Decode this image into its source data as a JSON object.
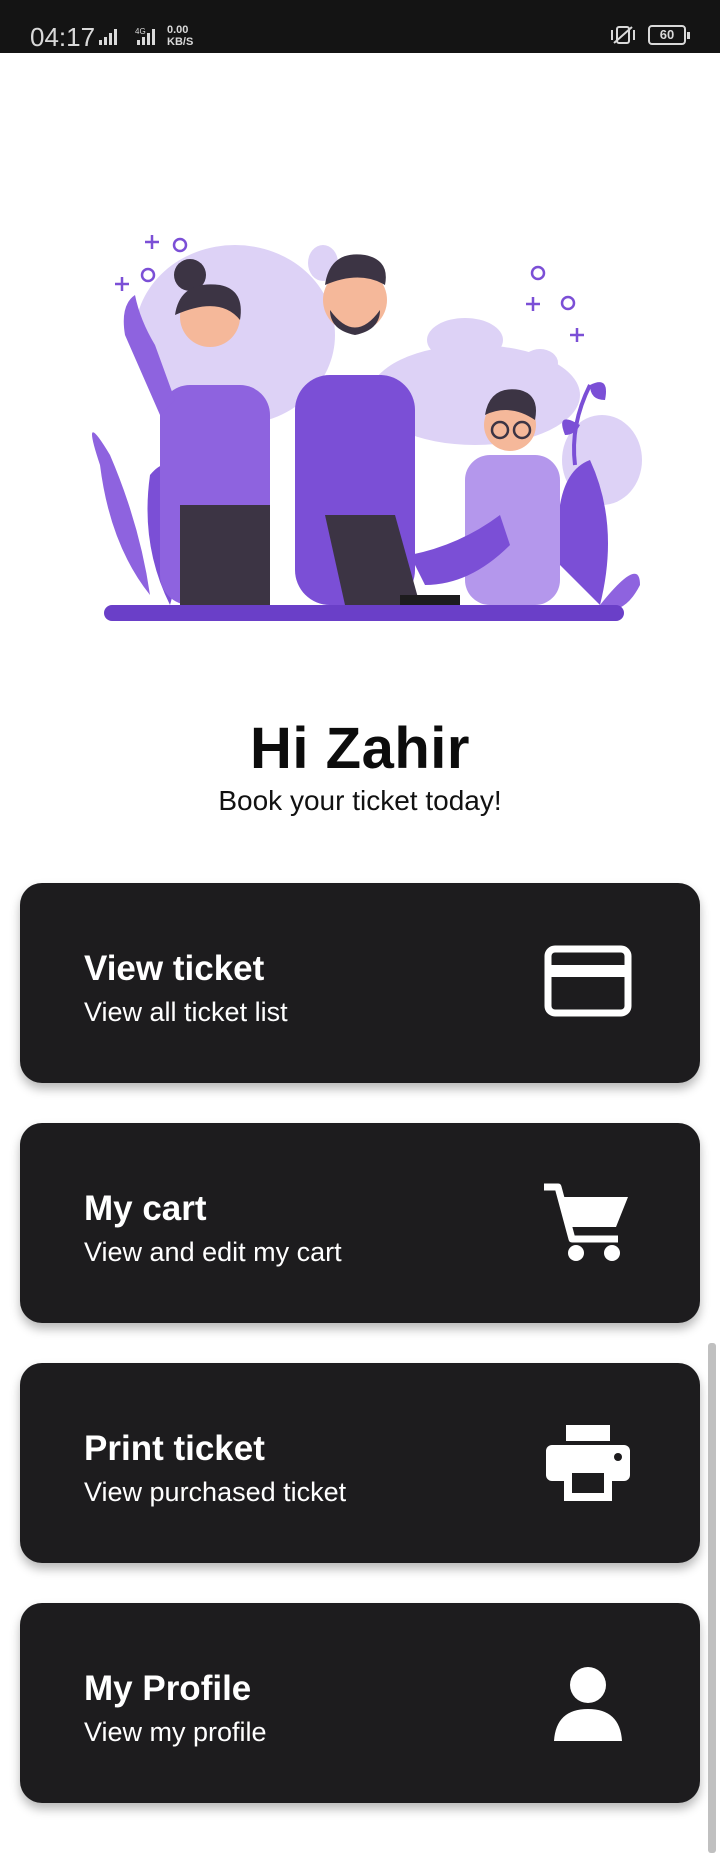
{
  "status_bar": {
    "time": "04:17",
    "network": "4G",
    "speed_value": "0.00",
    "speed_unit": "KB/S",
    "battery": "60"
  },
  "greeting": {
    "title": "Hi Zahir",
    "subtitle": "Book your ticket today!"
  },
  "menu": [
    {
      "title": "View ticket",
      "subtitle": "View all ticket list",
      "icon": "credit-card-icon"
    },
    {
      "title": "My cart",
      "subtitle": "View and edit my cart",
      "icon": "cart-icon"
    },
    {
      "title": "Print ticket",
      "subtitle": "View purchased ticket",
      "icon": "printer-icon"
    },
    {
      "title": "My Profile",
      "subtitle": "View my profile",
      "icon": "person-icon"
    }
  ],
  "colors": {
    "card_background": "#1d1c1e",
    "accent_purple": "#7b4fd6",
    "light_purple": "#ddd2f6"
  }
}
